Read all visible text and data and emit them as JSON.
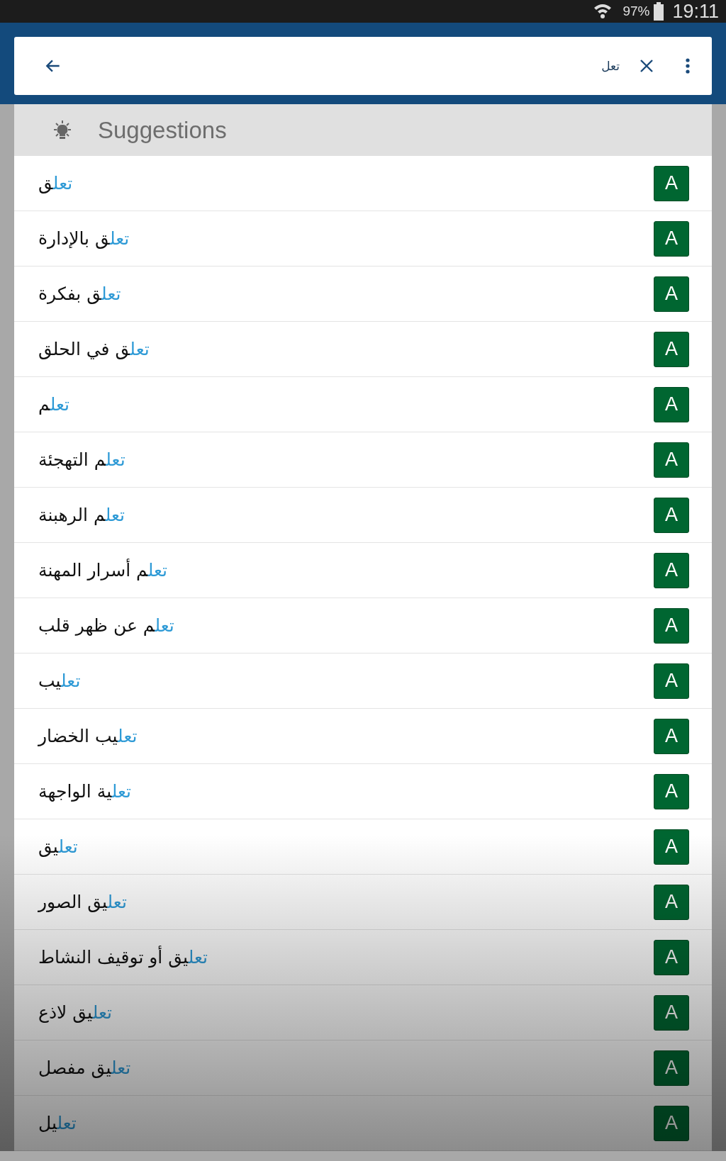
{
  "status_bar": {
    "battery": "97%",
    "time": "19:11"
  },
  "search": {
    "value": "تعل"
  },
  "suggestions": {
    "title": "Suggestions",
    "items": [
      {
        "match": "تعل",
        "rest": "ق",
        "badge": "A"
      },
      {
        "match": "تعل",
        "rest": "ق بالإدارة",
        "badge": "A"
      },
      {
        "match": "تعل",
        "rest": "ق بفكرة",
        "badge": "A"
      },
      {
        "match": "تعل",
        "rest": "ق في الحلق",
        "badge": "A"
      },
      {
        "match": "تعل",
        "rest": "م",
        "badge": "A"
      },
      {
        "match": "تعل",
        "rest": "م التهجئة",
        "badge": "A"
      },
      {
        "match": "تعل",
        "rest": "م الرهبنة",
        "badge": "A"
      },
      {
        "match": "تعل",
        "rest": "م أسرار المهنة",
        "badge": "A"
      },
      {
        "match": "تعل",
        "rest": "م عن ظهر قلب",
        "badge": "A"
      },
      {
        "match": "تعل",
        "rest": "يب",
        "badge": "A"
      },
      {
        "match": "تعل",
        "rest": "يب الخضار",
        "badge": "A"
      },
      {
        "match": "تعل",
        "rest": "ية الواجهة",
        "badge": "A"
      },
      {
        "match": "تعل",
        "rest": "يق",
        "badge": "A"
      },
      {
        "match": "تعل",
        "rest": "يق الصور",
        "badge": "A"
      },
      {
        "match": "تعل",
        "rest": "يق أو توقيف النشاط",
        "badge": "A"
      },
      {
        "match": "تعل",
        "rest": "يق لاذع",
        "badge": "A"
      },
      {
        "match": "تعل",
        "rest": "يق مفصل",
        "badge": "A"
      },
      {
        "match": "تعل",
        "rest": "يل",
        "badge": "A"
      }
    ]
  }
}
